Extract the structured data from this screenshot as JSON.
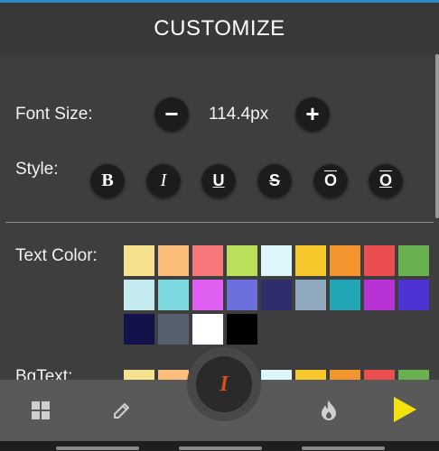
{
  "header": {
    "title": "CUSTOMIZE"
  },
  "font_size": {
    "label": "Font Size:",
    "value": "114.4px",
    "decrement": "−",
    "increment": "+"
  },
  "style": {
    "label": "Style:",
    "buttons": [
      {
        "name": "bold",
        "text": "B"
      },
      {
        "name": "italic",
        "text": "I"
      },
      {
        "name": "underline",
        "text": "U"
      },
      {
        "name": "strikethrough",
        "text": "S"
      },
      {
        "name": "overline",
        "text": "O"
      },
      {
        "name": "over-underline",
        "text": "O"
      }
    ]
  },
  "text_color": {
    "label": "Text Color:",
    "rows": [
      [
        "#f6e28e",
        "#fbbd79",
        "#f7787a",
        "#b9e05a",
        "#dcf6fb",
        "#f8c72b",
        "#f4942f",
        "#ea4e4e",
        "#69b050"
      ],
      [
        "#c3eaee",
        "#7cd9e0",
        "#df5ff3",
        "#6b70de",
        "#2f2e6c",
        "#91a9bf",
        "#21a6b5",
        "#b832d6",
        "#4d32d4"
      ],
      [
        "#12124a",
        "#56606e",
        "#ffffff",
        "#000000"
      ]
    ]
  },
  "bg_text": {
    "label": "BgText:",
    "swatches": [
      "#f6e28e",
      "#fbbd79",
      "#dcf6fb",
      "#f8c72b",
      "#f4942f",
      "#ea4e4e",
      "#69b050"
    ]
  },
  "bottom_nav": {
    "center_label": "I",
    "play_color": "#f4e20d",
    "icon_names": [
      "grid-icon",
      "pencil-icon",
      "text-style-icon",
      "flame-icon",
      "play-icon"
    ]
  }
}
